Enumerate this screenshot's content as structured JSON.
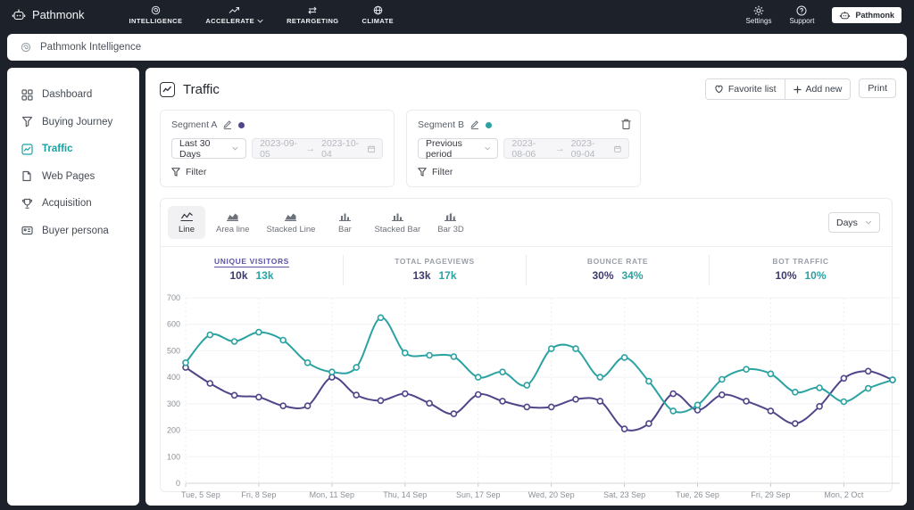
{
  "navbar": {
    "brand": "Pathmonk",
    "items": [
      {
        "label": "INTELLIGENCE",
        "icon": "intelligence-icon",
        "has_chevron": false
      },
      {
        "label": "ACCELERATE",
        "icon": "accelerate-icon",
        "has_chevron": true
      },
      {
        "label": "RETARGETING",
        "icon": "retargeting-icon",
        "has_chevron": false
      },
      {
        "label": "CLIMATE",
        "icon": "climate-icon",
        "has_chevron": false
      }
    ],
    "settings_label": "Settings",
    "support_label": "Support",
    "account_label": "Pathmonk"
  },
  "breadcrumb": {
    "title": "Pathmonk Intelligence"
  },
  "sidebar": {
    "items": [
      {
        "label": "Dashboard",
        "active": false
      },
      {
        "label": "Buying Journey",
        "active": false
      },
      {
        "label": "Traffic",
        "active": true
      },
      {
        "label": "Web Pages",
        "active": false
      },
      {
        "label": "Acquisition",
        "active": false
      },
      {
        "label": "Buyer persona",
        "active": false
      }
    ]
  },
  "header": {
    "title": "Traffic",
    "favorite_label": "Favorite list",
    "add_label": "Add new",
    "print_label": "Print"
  },
  "segments": [
    {
      "name": "Segment A",
      "color": "#4e4689",
      "preset": "Last 30 Days",
      "date_from": "2023-09-05",
      "date_to": "2023-10-04",
      "filter_label": "Filter",
      "deletable": false
    },
    {
      "name": "Segment B",
      "color": "#2ba2a2",
      "preset": "Previous period",
      "date_from": "2023-08-06",
      "date_to": "2023-09-04",
      "filter_label": "Filter",
      "deletable": true
    }
  ],
  "chart_tabs": [
    {
      "label": "Line",
      "active": true
    },
    {
      "label": "Area line",
      "active": false
    },
    {
      "label": "Stacked Line",
      "active": false
    },
    {
      "label": "Bar",
      "active": false
    },
    {
      "label": "Stacked Bar",
      "active": false
    },
    {
      "label": "Bar 3D",
      "active": false
    }
  ],
  "interval_select": {
    "value": "Days"
  },
  "stats": [
    {
      "label": "UNIQUE VISITORS",
      "segment_a": "10k",
      "segment_b": "13k",
      "active": true
    },
    {
      "label": "TOTAL PAGEVIEWS",
      "segment_a": "13k",
      "segment_b": "17k",
      "active": false
    },
    {
      "label": "BOUNCE RATE",
      "segment_a": "30%",
      "segment_b": "34%",
      "active": false
    },
    {
      "label": "BOT TRAFFIC",
      "segment_a": "10%",
      "segment_b": "10%",
      "active": false
    }
  ],
  "chart_data": {
    "type": "line",
    "smooth": true,
    "markers": true,
    "legend": "none",
    "grid": {
      "horizontal": true,
      "vertical_dashed": true
    },
    "ylim": [
      0,
      700
    ],
    "yticks": [
      0,
      100,
      200,
      300,
      400,
      500,
      600,
      700
    ],
    "x": [
      "Tue, 5 Sep",
      "Wed, 6 Sep",
      "Thu, 7 Sep",
      "Fri, 8 Sep",
      "Sat, 9 Sep",
      "Sun, 10 Sep",
      "Mon, 11 Sep",
      "Tue, 12 Sep",
      "Wed, 13 Sep",
      "Thu, 14 Sep",
      "Fri, 15 Sep",
      "Sat, 16 Sep",
      "Sun, 17 Sep",
      "Mon, 18 Sep",
      "Tue, 19 Sep",
      "Wed, 20 Sep",
      "Thu, 21 Sep",
      "Fri, 22 Sep",
      "Sat, 23 Sep",
      "Sun, 24 Sep",
      "Mon, 25 Sep",
      "Tue, 26 Sep",
      "Wed, 27 Sep",
      "Thu, 28 Sep",
      "Fri, 29 Sep",
      "Sat, 30 Sep",
      "Sun, 1 Oct",
      "Mon, 2 Oct",
      "Tue, 3 Oct",
      "Wed, 4 Oct"
    ],
    "x_tick_indices": [
      0,
      3,
      6,
      9,
      12,
      15,
      18,
      21,
      24,
      27
    ],
    "series": [
      {
        "name": "Segment A",
        "color": "#4e4689",
        "values": [
          437,
          377,
          332,
          325,
          292,
          292,
          400,
          333,
          312,
          338,
          302,
          262,
          335,
          310,
          288,
          288,
          317,
          310,
          205,
          225,
          338,
          276,
          334,
          310,
          273,
          225,
          290,
          396,
          423,
          390
        ]
      },
      {
        "name": "Segment B",
        "color": "#2ba2a2",
        "values": [
          455,
          560,
          535,
          570,
          540,
          455,
          420,
          437,
          625,
          492,
          483,
          478,
          400,
          420,
          370,
          508,
          508,
          400,
          475,
          385,
          273,
          295,
          392,
          430,
          413,
          344,
          360,
          308,
          358,
          390
        ]
      }
    ]
  }
}
